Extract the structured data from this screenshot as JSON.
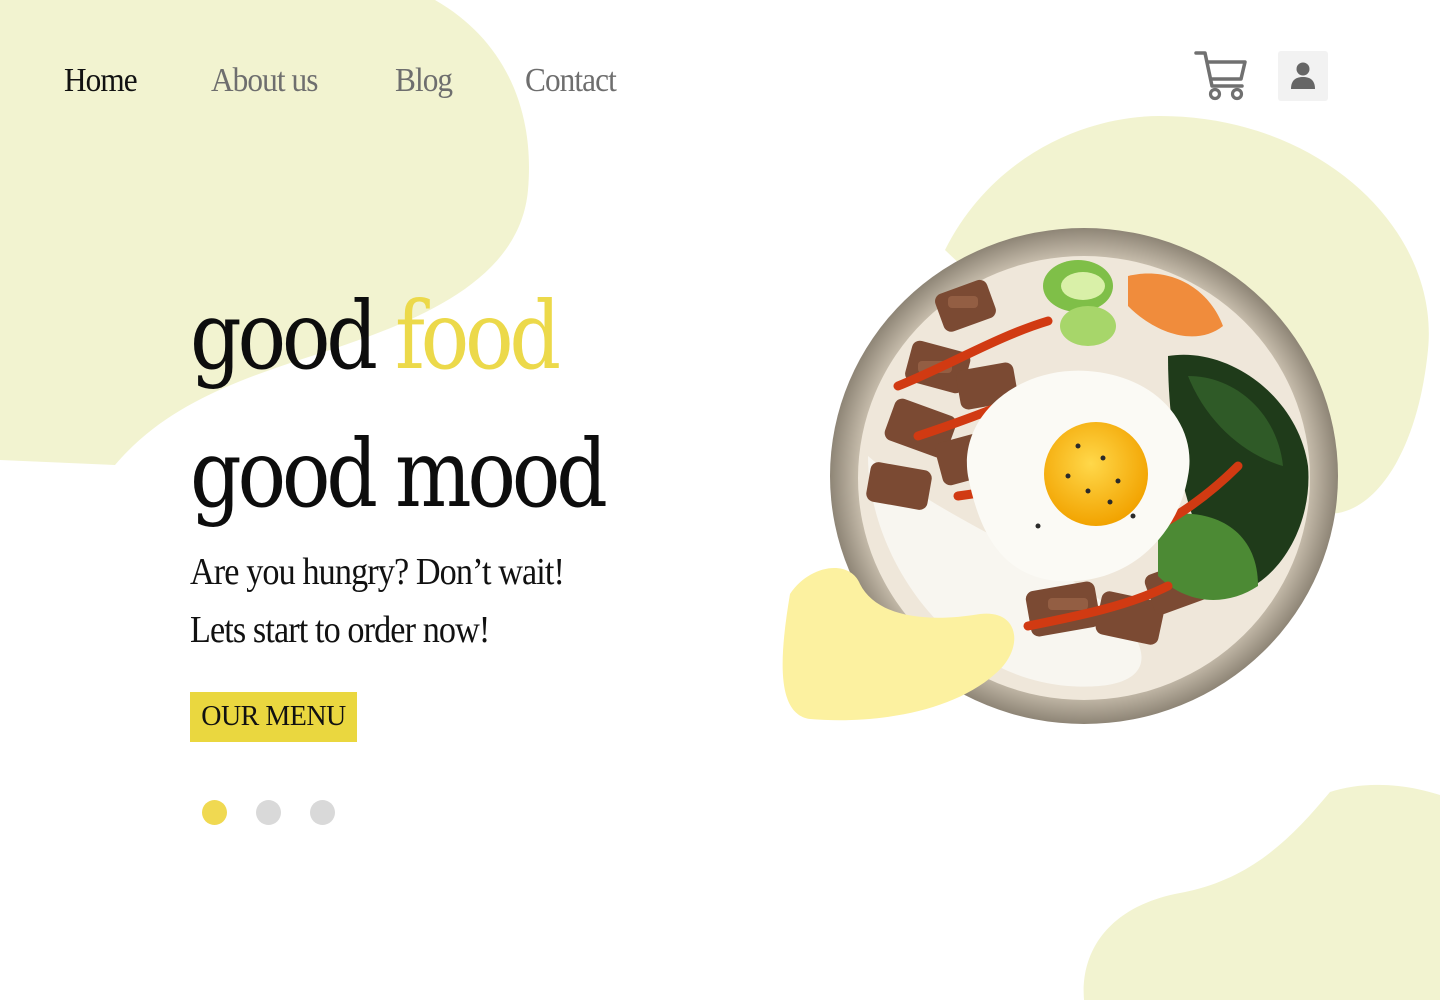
{
  "nav": {
    "links": [
      {
        "label": "Home",
        "active": true
      },
      {
        "label": "About us",
        "active": false
      },
      {
        "label": "Blog",
        "active": false
      },
      {
        "label": "Contact",
        "active": false
      }
    ]
  },
  "header_icons": [
    "cart-icon",
    "user-icon"
  ],
  "hero": {
    "line1_word1": "good",
    "line1_word2": "food",
    "line2": "good mood",
    "sub1": "Are you hungry? Don’t wait!",
    "sub2": "Lets start to order now!",
    "cta": "OUR MENU"
  },
  "carousel": {
    "count": 3,
    "active_index": 0
  },
  "colors": {
    "accent": "#ecd94a",
    "button": "#ead73f",
    "blob": "#f2f3d0",
    "blob_front": "#fcf1a0",
    "dot_inactive": "#d9d9d9",
    "dot_active": "#f0d951"
  }
}
